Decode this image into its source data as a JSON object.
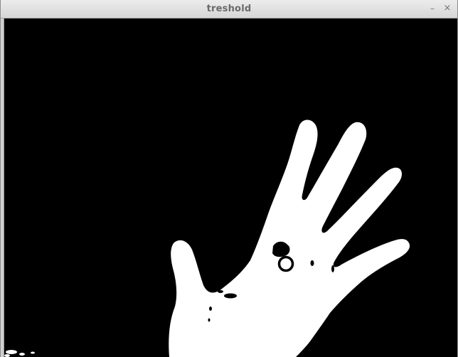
{
  "window": {
    "title": "treshold",
    "minimize_glyph": "–",
    "close_glyph": "×"
  },
  "image": {
    "description_icon": "binary-threshold-hand-image",
    "foreground_color": "#ffffff",
    "background_color": "#000000"
  }
}
